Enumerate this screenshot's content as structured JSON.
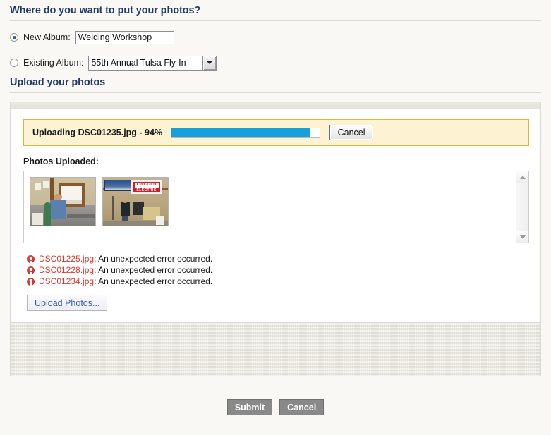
{
  "album_section": {
    "heading": "Where do you want to put your photos?",
    "new_album": {
      "label": "New Album:",
      "value": "Welding Workshop",
      "placeholder": "",
      "selected": true
    },
    "existing_album": {
      "label": "Existing Album:",
      "value": "55th Annual Tulsa Fly-In",
      "selected": false,
      "arrow_icon": "chevron-down-icon"
    }
  },
  "upload_section": {
    "heading": "Upload your photos",
    "uploading": {
      "text": "Uploading DSC01235.jpg - 94%",
      "percent": 94,
      "bar_color": "#17a0da",
      "cancel_label": "Cancel"
    },
    "photos_uploaded": {
      "label": "Photos Uploaded:",
      "thumbnails": [
        {
          "name": "thumbnail-dsc01231",
          "alt": "Man standing in welding workshop near bright window"
        },
        {
          "name": "thumbnail-dsc01232",
          "alt": "Workshop with Lincoln Electric banner and person at bench"
        }
      ],
      "scrollbar": {
        "up_icon": "triangle-up-icon",
        "down_icon": "triangle-down-icon"
      }
    },
    "errors": [
      {
        "icon": "error-icon",
        "file": "DSC01225.jpg",
        "message": ": An unexpected error occurred."
      },
      {
        "icon": "error-icon",
        "file": "DSC01228.jpg",
        "message": ": An unexpected error occurred."
      },
      {
        "icon": "error-icon",
        "file": "DSC01234.jpg",
        "message": ": An unexpected error occurred."
      }
    ],
    "upload_button_label": "Upload Photos..."
  },
  "footer": {
    "submit_label": "Submit",
    "cancel_label": "Cancel"
  },
  "colors": {
    "heading": "#1f3a66",
    "error_text": "#d63a2e",
    "progress": "#17a0da",
    "notice_bg": "#fdf3d2",
    "notice_border": "#e0b53c"
  }
}
